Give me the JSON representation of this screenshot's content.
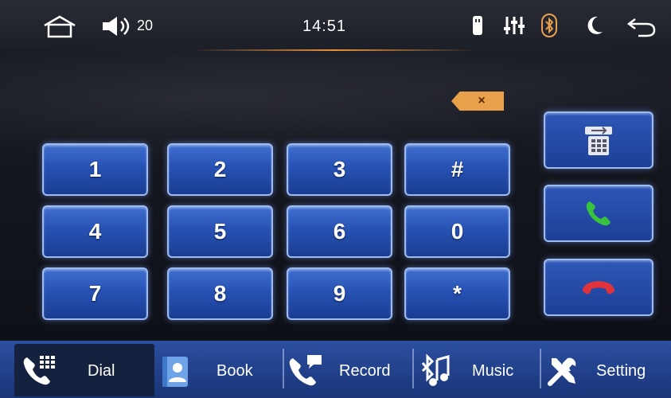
{
  "status_bar": {
    "time": "14:51",
    "volume": "20",
    "icons": [
      "home-icon",
      "volume-icon",
      "usb-icon",
      "equalizer-icon",
      "bluetooth-icon",
      "night-mode-icon",
      "back-icon"
    ]
  },
  "dialpad": {
    "keys": [
      "1",
      "2",
      "3",
      "#",
      "4",
      "5",
      "6",
      "0",
      "7",
      "8",
      "9",
      "*"
    ],
    "delete_label": "×"
  },
  "side_buttons": {
    "transfer": "phone-transfer-icon",
    "call": "call-icon",
    "hangup": "hangup-icon"
  },
  "nav": {
    "dial": "Dial",
    "book": "Book",
    "record": "Record",
    "music": "Music",
    "setting": "Setting"
  },
  "colors": {
    "accent_orange": "#e8a04a",
    "call_green": "#39c23d",
    "hangup_red": "#e0333a",
    "key_blue": "#2752b4"
  }
}
